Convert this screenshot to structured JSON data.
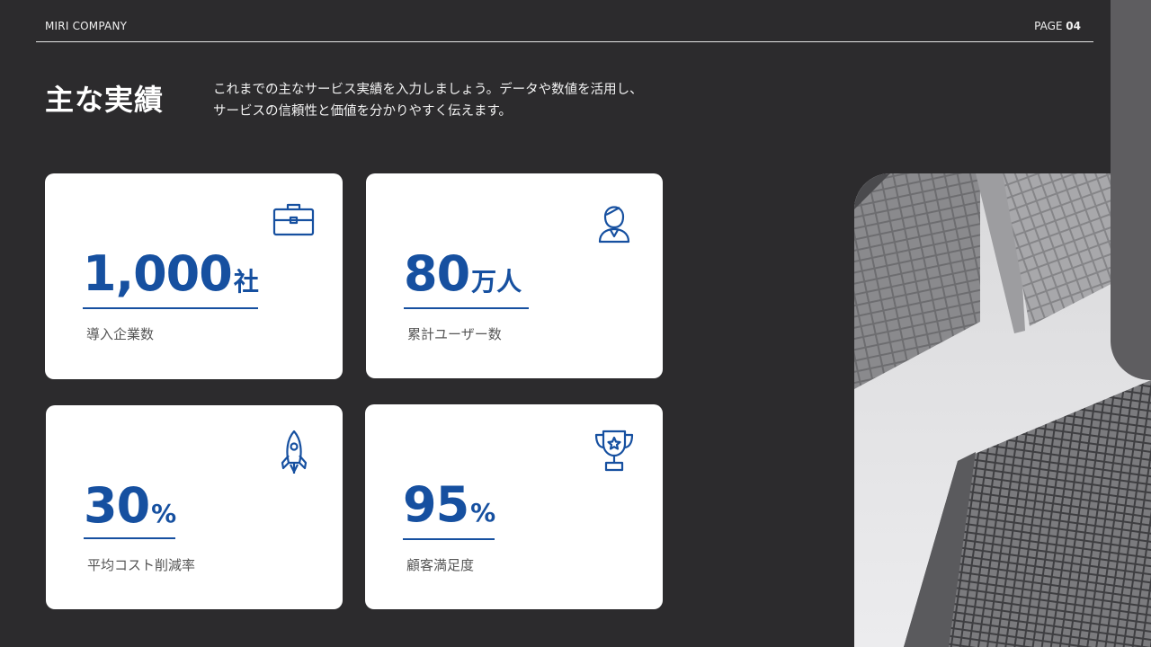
{
  "header": {
    "company": "MIRI COMPANY",
    "page_prefix": "PAGE",
    "page_number": "04"
  },
  "title": "主な実績",
  "description": {
    "line1": "これまでの主なサービス実績を入力しましょう。データや数値を活用し、",
    "line2": "サービスの信頼性と価値を分かりやすく伝えます。"
  },
  "stats": [
    {
      "number": "1,000",
      "unit": "社",
      "label": "導入企業数",
      "icon": "briefcase-icon"
    },
    {
      "number": "80",
      "unit": "万人",
      "label": "累計ユーザー数",
      "icon": "person-icon"
    },
    {
      "number": "30",
      "unit": "%",
      "label": "平均コスト削減率",
      "icon": "rocket-icon"
    },
    {
      "number": "95",
      "unit": "%",
      "label": "顧客満足度",
      "icon": "trophy-icon"
    }
  ],
  "photo": {
    "subject": "skyscrapers-photo"
  },
  "colors": {
    "background": "#2c2b2d",
    "accent": "#1650a0",
    "card": "#ffffff",
    "side_tab": "#5e5d60"
  }
}
